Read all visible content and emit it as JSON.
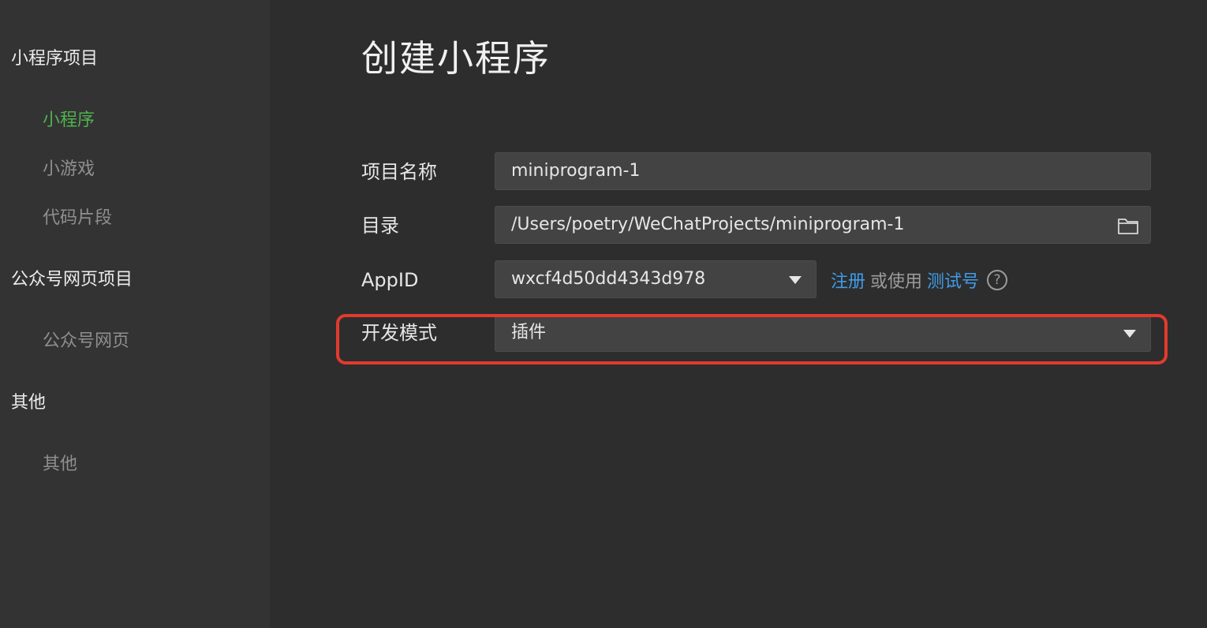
{
  "sidebar": {
    "groups": [
      {
        "label": "小程序项目",
        "items": [
          {
            "label": "小程序",
            "active": true
          },
          {
            "label": "小游戏"
          },
          {
            "label": "代码片段"
          }
        ]
      },
      {
        "label": "公众号网页项目",
        "items": [
          {
            "label": "公众号网页"
          }
        ]
      },
      {
        "label": "其他",
        "items": [
          {
            "label": "其他"
          }
        ]
      }
    ]
  },
  "main": {
    "title": "创建小程序",
    "form": {
      "project_name": {
        "label": "项目名称",
        "value": "miniprogram-1"
      },
      "directory": {
        "label": "目录",
        "value": "/Users/poetry/WeChatProjects/miniprogram-1",
        "icon": "folder-icon"
      },
      "appid": {
        "label": "AppID",
        "value": "wxcf4d50dd4343d978",
        "register_link": "注册",
        "or_use": "或使用",
        "test_account_link": "测试号",
        "help_icon": "?"
      },
      "dev_mode": {
        "label": "开发模式",
        "value": "插件"
      }
    }
  },
  "colors": {
    "sidebar_bg": "#333333",
    "main_bg": "#2d2d2d",
    "active_item": "#4fb24e",
    "link": "#3f9be8",
    "highlight": "#e23a2e"
  }
}
